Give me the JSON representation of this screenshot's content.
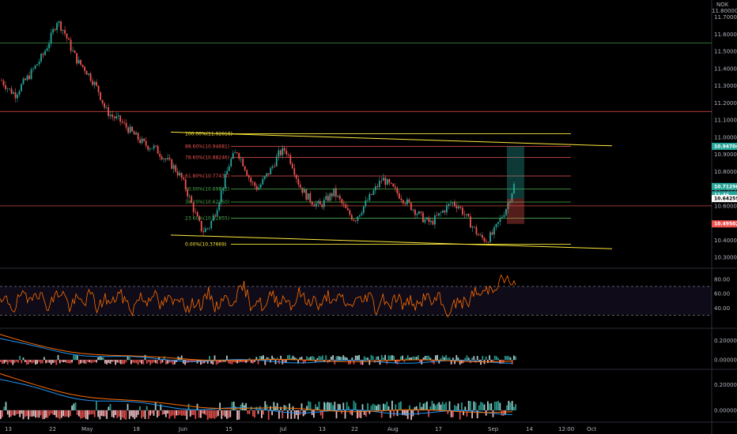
{
  "chart_data": {
    "type": "candlestick",
    "currency_label": "NOK",
    "top_price_label": "11.80000",
    "price_axis": {
      "ticks": [
        "11.70000",
        "11.60000",
        "11.50000",
        "11.40000",
        "11.30000",
        "11.20000",
        "11.10000",
        "11.00000",
        "10.90000",
        "10.80000",
        "10.70000",
        "10.60000",
        "10.50000",
        "10.40000",
        "10.30000"
      ],
      "ylim": [
        10.25,
        11.8
      ]
    },
    "price_tags": [
      {
        "label": "10.94704",
        "value": 10.94704,
        "color": "#26a69a"
      },
      {
        "label": "10.71296",
        "value": 10.71296,
        "color": "#26a69a"
      },
      {
        "label": "11:46",
        "value": 10.665,
        "color": "#26a69a"
      },
      {
        "label": "10.64259",
        "value": 10.64259,
        "color": "#ffffff"
      },
      {
        "label": "10.49502",
        "value": 10.49502,
        "color": "#ef5350"
      }
    ],
    "time_axis": [
      "13",
      "22",
      "May",
      "18",
      "Jun",
      "15",
      "Jul",
      "13",
      "22",
      "Aug",
      "17",
      "Sep",
      "14",
      "12:00",
      "Oct"
    ],
    "horizontal_levels": [
      {
        "value": 11.55,
        "color": "#4caf50"
      },
      {
        "value": 11.15,
        "color": "#ef5350"
      },
      {
        "value": 10.6,
        "color": "#ef5350"
      }
    ],
    "fibonacci": [
      {
        "label": "100.00%(11.02016)",
        "value": 11.02016,
        "color": "#ffeb3b"
      },
      {
        "label": "88.60%(10.94681)",
        "value": 10.94681,
        "color": "#ef5350"
      },
      {
        "label": "78.60%(10.88246)",
        "value": 10.88246,
        "color": "#ef5350"
      },
      {
        "label": "61.80%(10.77434)",
        "value": 10.77434,
        "color": "#ef5350"
      },
      {
        "label": "50.00%(10.69843)",
        "value": 10.69843,
        "color": "#4caf50"
      },
      {
        "label": "38.20%(10.62250)",
        "value": 10.6225,
        "color": "#4caf50"
      },
      {
        "label": "23.60%(10.52855)",
        "value": 10.52855,
        "color": "#4caf50"
      },
      {
        "label": "0.00%(10.37669)",
        "value": 10.37669,
        "color": "#ffeb3b"
      }
    ],
    "channel": {
      "upper": {
        "from": [
          0.24,
          11.03
        ],
        "to": [
          0.78,
          10.95
        ]
      },
      "lower": {
        "from": [
          0.24,
          10.43
        ],
        "to": [
          0.78,
          10.35
        ]
      }
    },
    "price_series_close": [
      11.33,
      11.28,
      11.25,
      11.31,
      11.36,
      11.42,
      11.48,
      11.57,
      11.68,
      11.62,
      11.52,
      11.44,
      11.4,
      11.34,
      11.27,
      11.16,
      11.12,
      11.1,
      11.06,
      11.02,
      10.98,
      10.95,
      10.94,
      10.9,
      10.86,
      10.82,
      10.76,
      10.66,
      10.55,
      10.45,
      10.48,
      10.58,
      10.72,
      10.86,
      10.92,
      10.84,
      10.74,
      10.7,
      10.76,
      10.82,
      10.9,
      10.93,
      10.84,
      10.72,
      10.66,
      10.62,
      10.6,
      10.64,
      10.68,
      10.62,
      10.56,
      10.52,
      10.58,
      10.64,
      10.7,
      10.76,
      10.72,
      10.68,
      10.64,
      10.6,
      10.56,
      10.52,
      10.5,
      10.54,
      10.58,
      10.62,
      10.6,
      10.54,
      10.48,
      10.42,
      10.4,
      10.44,
      10.52,
      10.6,
      10.72
    ],
    "rsi": {
      "ticks": [
        "80.00",
        "60.00",
        "40.00"
      ],
      "ylim": [
        15,
        92
      ],
      "upper_band": 70,
      "lower_band": 30,
      "values": [
        45,
        52,
        38,
        60,
        48,
        66,
        55,
        42,
        58,
        63,
        40,
        52,
        47,
        61,
        38,
        55,
        44,
        62,
        50,
        36,
        57,
        48,
        64,
        41,
        53,
        46,
        59,
        35,
        51,
        43,
        62,
        39,
        56,
        47,
        58,
        70,
        44,
        52,
        37,
        61,
        49,
        55,
        42,
        63,
        47,
        54,
        38,
        60,
        45,
        57,
        40,
        52,
        49,
        61,
        36,
        56,
        44,
        58,
        41,
        53,
        39,
        59,
        46,
        55,
        32,
        42,
        50,
        44,
        63,
        58,
        66,
        70,
        82,
        78,
        70
      ]
    },
    "osc1": {
      "ticks": [
        "0.20000",
        "0.00000"
      ],
      "ylim": [
        -0.08,
        0.3
      ]
    },
    "osc2": {
      "ticks": [
        "0.20000",
        "0.00000"
      ],
      "ylim": [
        -0.08,
        0.3
      ]
    }
  }
}
